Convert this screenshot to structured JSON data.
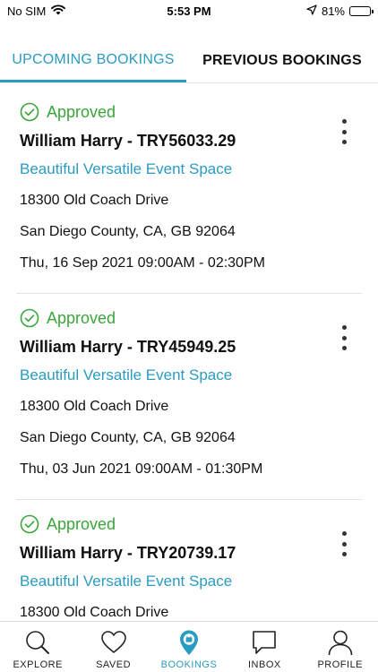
{
  "status_bar": {
    "carrier": "No SIM",
    "time": "5:53 PM",
    "battery": "81%",
    "battery_level": 0.81
  },
  "tabs": [
    {
      "label": "UPCOMING BOOKINGS",
      "active": true
    },
    {
      "label": "PREVIOUS BOOKINGS",
      "active": false
    }
  ],
  "bookings": [
    {
      "status": "Approved",
      "title": "William Harry - TRY56033.29",
      "venue": "Beautiful Versatile Event Space",
      "address_line1": "18300 Old Coach Drive",
      "address_line2": "San Diego County, CA, GB 92064",
      "datetime": "Thu, 16 Sep 2021 09:00AM - 02:30PM"
    },
    {
      "status": "Approved",
      "title": "William Harry - TRY45949.25",
      "venue": "Beautiful Versatile Event Space",
      "address_line1": "18300 Old Coach Drive",
      "address_line2": "San Diego County, CA, GB 92064",
      "datetime": "Thu, 03 Jun 2021 09:00AM - 01:30PM"
    },
    {
      "status": "Approved",
      "title": "William Harry - TRY20739.17",
      "venue": "Beautiful Versatile Event Space",
      "address_line1": "18300 Old Coach Drive",
      "address_line2": "",
      "datetime": ""
    }
  ],
  "nav": [
    {
      "label": "EXPLORE",
      "icon": "search-icon",
      "active": false
    },
    {
      "label": "SAVED",
      "icon": "heart-icon",
      "active": false
    },
    {
      "label": "BOOKINGS",
      "icon": "bookings-pin-icon",
      "active": true
    },
    {
      "label": "INBOX",
      "icon": "chat-icon",
      "active": false
    },
    {
      "label": "PROFILE",
      "icon": "user-icon",
      "active": false
    }
  ],
  "colors": {
    "accent": "#2a9bc1",
    "approved": "#3aa63a",
    "text": "#111111"
  }
}
